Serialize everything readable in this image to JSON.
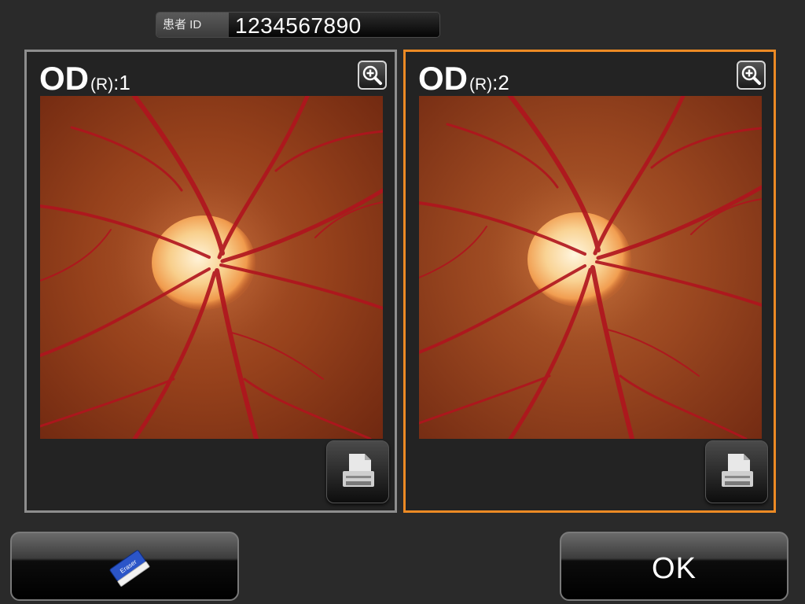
{
  "patient": {
    "label": "患者 ID",
    "id": "1234567890"
  },
  "panels": [
    {
      "eye": "OD",
      "side": "(R)",
      "number": ":1",
      "selected": false
    },
    {
      "eye": "OD",
      "side": "(R)",
      "number": ":2",
      "selected": true
    }
  ],
  "icons": {
    "zoom": "zoom-in-icon",
    "print": "printer-icon",
    "erase": "eraser-icon"
  },
  "eraser_text": "Eraser",
  "ok_label": "OK",
  "colors": {
    "selected_border": "#ec8a24",
    "panel_border": "#8e8e8e",
    "background": "#2a2a2a"
  }
}
